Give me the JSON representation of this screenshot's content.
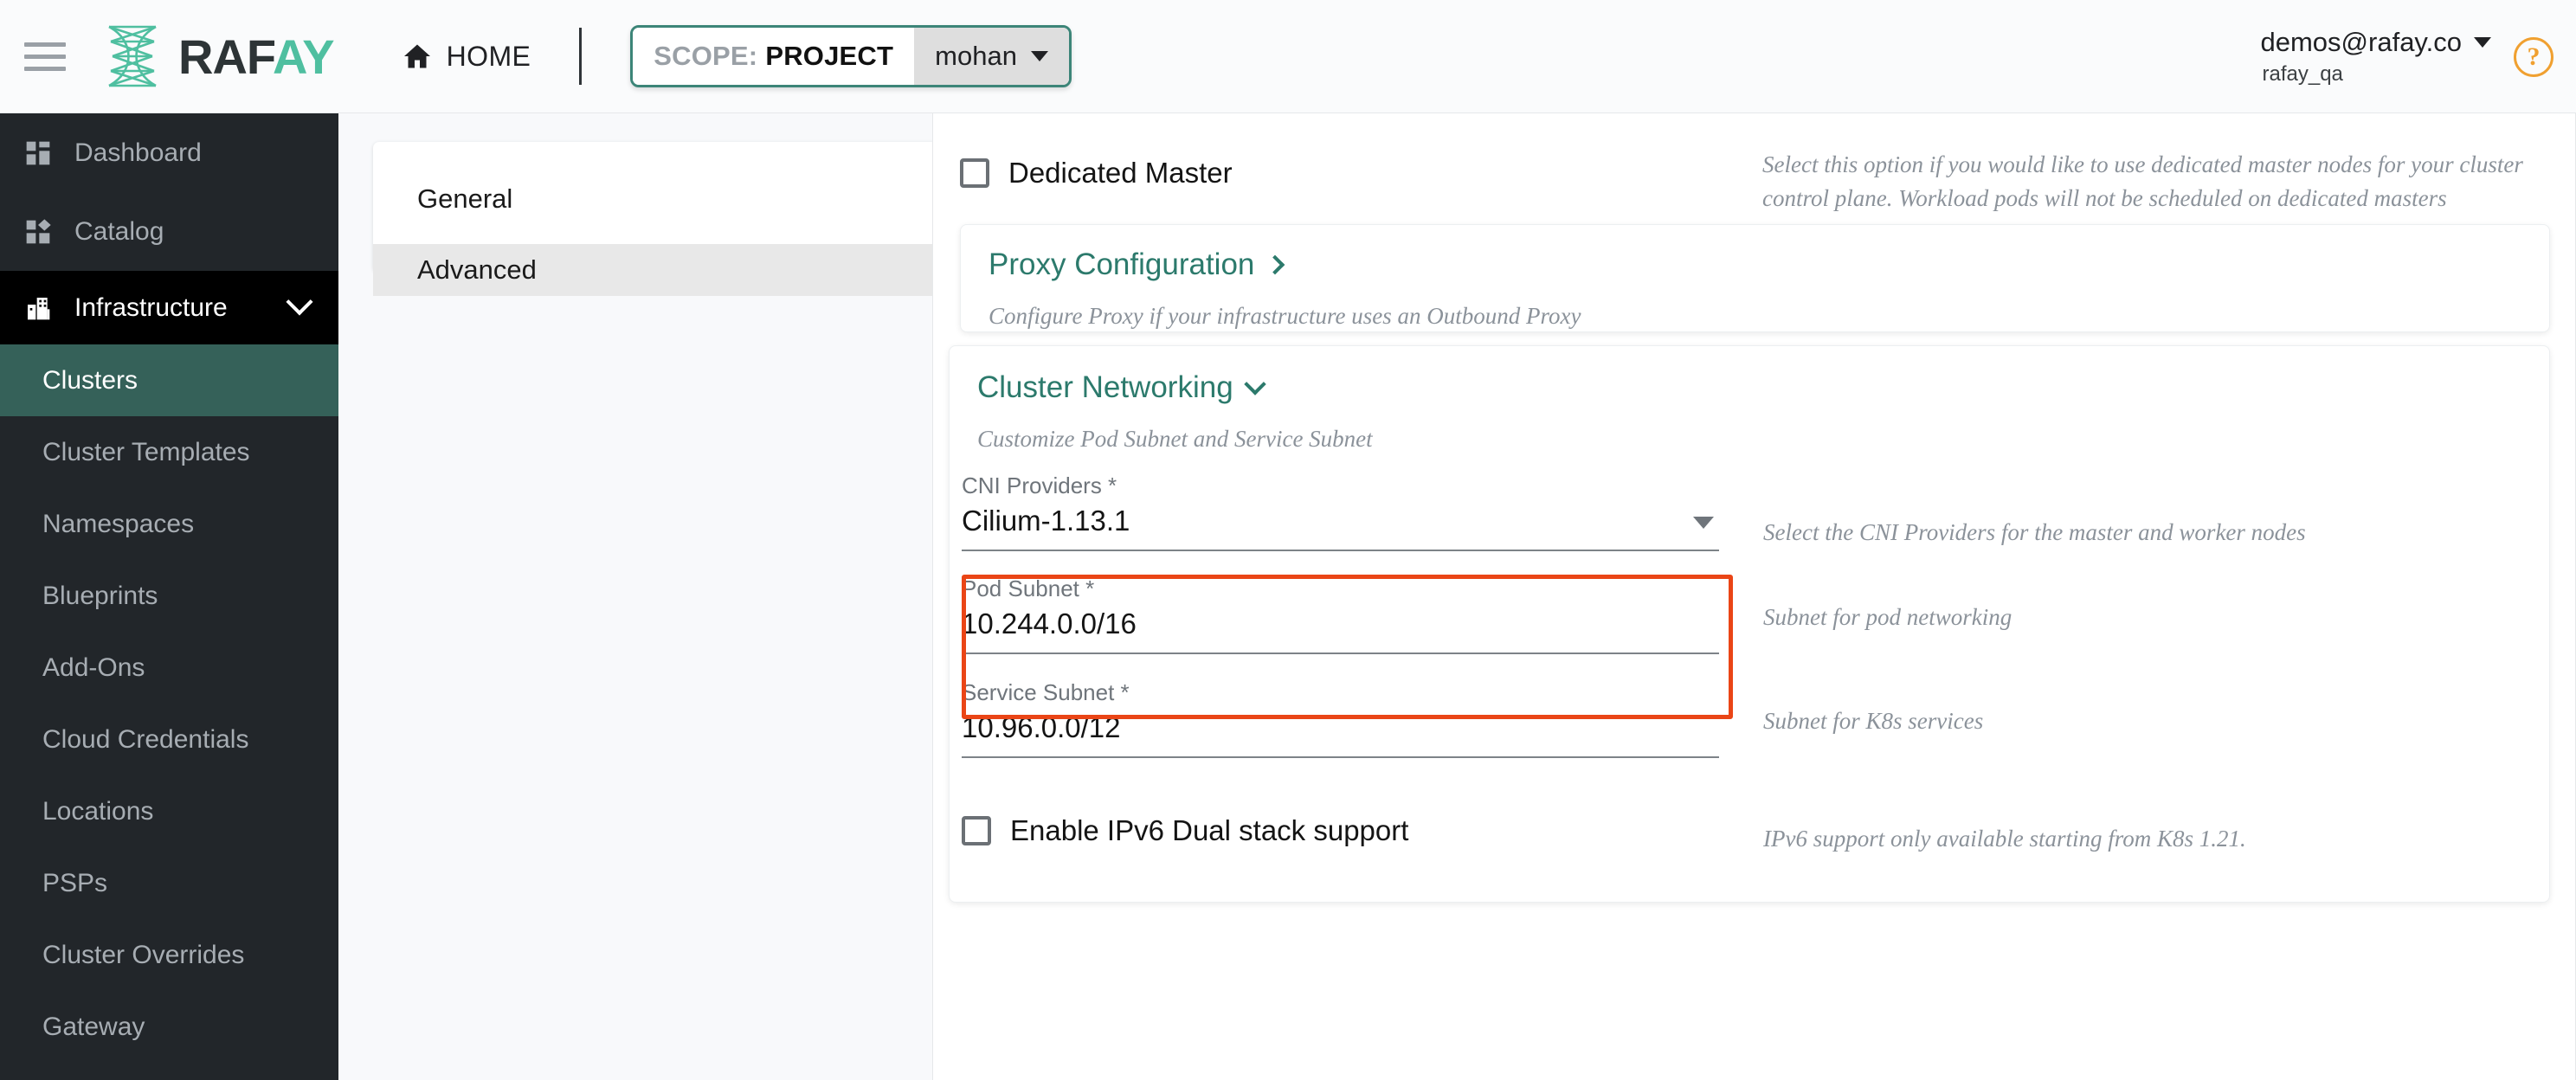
{
  "topbar": {
    "menu_icon": "hamburger-icon",
    "brand": "RAFAY",
    "brand_head": "RAF",
    "brand_tail": "AY",
    "home_label": "HOME",
    "home_icon": "home-icon",
    "scope_prefix": "SCOPE:",
    "scope_type": "PROJECT",
    "scope_value": "mohan",
    "user_email": "demos@rafay.co",
    "user_org": "rafay_qa",
    "help_icon": "help-circle-icon"
  },
  "sidebar": {
    "items": [
      {
        "label": "Dashboard",
        "icon": "dashboard-icon",
        "type": "top"
      },
      {
        "label": "Catalog",
        "icon": "catalog-icon",
        "type": "top"
      },
      {
        "label": "Infrastructure",
        "icon": "infrastructure-icon",
        "type": "group",
        "expanded": true
      }
    ],
    "sub_items": [
      {
        "label": "Clusters",
        "active": true
      },
      {
        "label": "Cluster Templates",
        "active": false
      },
      {
        "label": "Namespaces",
        "active": false
      },
      {
        "label": "Blueprints",
        "active": false
      },
      {
        "label": "Add-Ons",
        "active": false
      },
      {
        "label": "Cloud Credentials",
        "active": false
      },
      {
        "label": "Locations",
        "active": false
      },
      {
        "label": "PSPs",
        "active": false
      },
      {
        "label": "Cluster Overrides",
        "active": false
      },
      {
        "label": "Gateway",
        "active": false
      }
    ]
  },
  "tabs": [
    {
      "label": "General",
      "active": false
    },
    {
      "label": "Advanced",
      "active": true
    }
  ],
  "form": {
    "dedicated_master": {
      "label": "Dedicated Master",
      "checked": false,
      "hint": "Select this option if you would like to use dedicated master nodes for your cluster control plane. Workload pods will not be scheduled on dedicated masters"
    },
    "proxy_configuration": {
      "title": "Proxy Configuration",
      "chevron": "chevron-right-icon",
      "hint": "Configure Proxy if your infrastructure uses an Outbound Proxy"
    },
    "cluster_networking": {
      "title": "Cluster Networking",
      "chevron": "chevron-down-icon",
      "subtitle": "Customize Pod Subnet and Service Subnet",
      "highlighted": true,
      "highlight_color": "#ea4516",
      "cni_providers": {
        "label": "CNI Providers *",
        "value": "Cilium-1.13.1",
        "hint": "Select the CNI Providers for the master and worker nodes"
      },
      "pod_subnet": {
        "label": "Pod Subnet *",
        "value": "10.244.0.0/16",
        "hint": "Subnet for pod networking"
      },
      "service_subnet": {
        "label": "Service Subnet *",
        "value": "10.96.0.0/12",
        "hint": "Subnet for K8s services"
      },
      "ipv6_dual_stack": {
        "label": "Enable IPv6 Dual stack support",
        "checked": false,
        "hint": "IPv6 support only available starting from K8s 1.21."
      }
    }
  },
  "colors": {
    "brand_teal": "#4fbfa0",
    "accent_teal": "#2c7a6c",
    "sidebar_bg": "#22262a",
    "sidebar_active": "#356159",
    "highlight_red": "#ea4516",
    "help_orange": "#f0a030"
  }
}
